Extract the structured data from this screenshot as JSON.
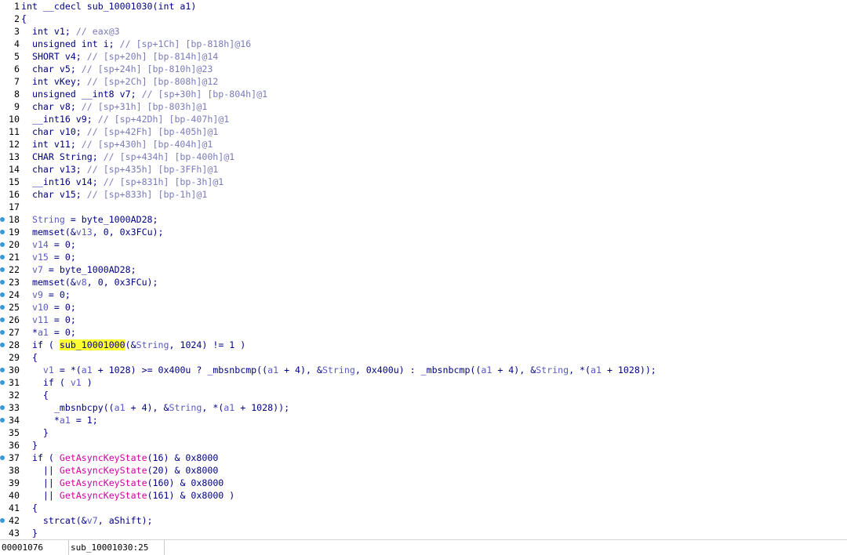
{
  "pseudocode": {
    "lines": [
      {
        "num": "1",
        "bp": false,
        "segs": [
          {
            "t": "int __cdecl sub_10001030(int a1)",
            "c": "k"
          }
        ]
      },
      {
        "num": "2",
        "bp": false,
        "segs": [
          {
            "t": "{",
            "c": "k"
          }
        ]
      },
      {
        "num": "3",
        "bp": false,
        "segs": [
          {
            "t": "  int v1; ",
            "c": "k"
          },
          {
            "t": "// eax@3",
            "c": "c"
          }
        ]
      },
      {
        "num": "4",
        "bp": false,
        "segs": [
          {
            "t": "  unsigned int i; ",
            "c": "k"
          },
          {
            "t": "// [sp+1Ch] [bp-818h]@16",
            "c": "c"
          }
        ]
      },
      {
        "num": "5",
        "bp": false,
        "segs": [
          {
            "t": "  SHORT v4; ",
            "c": "k"
          },
          {
            "t": "// [sp+20h] [bp-814h]@14",
            "c": "c"
          }
        ]
      },
      {
        "num": "6",
        "bp": false,
        "segs": [
          {
            "t": "  char v5; ",
            "c": "k"
          },
          {
            "t": "// [sp+24h] [bp-810h]@23",
            "c": "c"
          }
        ]
      },
      {
        "num": "7",
        "bp": false,
        "segs": [
          {
            "t": "  int vKey; ",
            "c": "k"
          },
          {
            "t": "// [sp+2Ch] [bp-808h]@12",
            "c": "c"
          }
        ]
      },
      {
        "num": "8",
        "bp": false,
        "segs": [
          {
            "t": "  unsigned __int8 v7; ",
            "c": "k"
          },
          {
            "t": "// [sp+30h] [bp-804h]@1",
            "c": "c"
          }
        ]
      },
      {
        "num": "9",
        "bp": false,
        "segs": [
          {
            "t": "  char v8; ",
            "c": "k"
          },
          {
            "t": "// [sp+31h] [bp-803h]@1",
            "c": "c"
          }
        ]
      },
      {
        "num": "10",
        "bp": false,
        "segs": [
          {
            "t": "  __int16 v9; ",
            "c": "k"
          },
          {
            "t": "// [sp+42Dh] [bp-407h]@1",
            "c": "c"
          }
        ]
      },
      {
        "num": "11",
        "bp": false,
        "segs": [
          {
            "t": "  char v10; ",
            "c": "k"
          },
          {
            "t": "// [sp+42Fh] [bp-405h]@1",
            "c": "c"
          }
        ]
      },
      {
        "num": "12",
        "bp": false,
        "segs": [
          {
            "t": "  int v11; ",
            "c": "k"
          },
          {
            "t": "// [sp+430h] [bp-404h]@1",
            "c": "c"
          }
        ]
      },
      {
        "num": "13",
        "bp": false,
        "segs": [
          {
            "t": "  CHAR String; ",
            "c": "k"
          },
          {
            "t": "// [sp+434h] [bp-400h]@1",
            "c": "c"
          }
        ]
      },
      {
        "num": "14",
        "bp": false,
        "segs": [
          {
            "t": "  char v13; ",
            "c": "k"
          },
          {
            "t": "// [sp+435h] [bp-3FFh]@1",
            "c": "c"
          }
        ]
      },
      {
        "num": "15",
        "bp": false,
        "segs": [
          {
            "t": "  __int16 v14; ",
            "c": "k"
          },
          {
            "t": "// [sp+831h] [bp-3h]@1",
            "c": "c"
          }
        ]
      },
      {
        "num": "16",
        "bp": false,
        "segs": [
          {
            "t": "  char v15; ",
            "c": "k"
          },
          {
            "t": "// [sp+833h] [bp-1h]@1",
            "c": "c"
          }
        ]
      },
      {
        "num": "17",
        "bp": false,
        "segs": [
          {
            "t": "",
            "c": "k"
          }
        ]
      },
      {
        "num": "18",
        "bp": true,
        "segs": [
          {
            "t": "  ",
            "c": "k"
          },
          {
            "t": "String",
            "c": "v"
          },
          {
            "t": " = byte_1000AD28;",
            "c": "k"
          }
        ]
      },
      {
        "num": "19",
        "bp": true,
        "segs": [
          {
            "t": "  memset(&",
            "c": "k"
          },
          {
            "t": "v13",
            "c": "v"
          },
          {
            "t": ", 0, 0x3FCu);",
            "c": "k"
          }
        ]
      },
      {
        "num": "20",
        "bp": true,
        "segs": [
          {
            "t": "  ",
            "c": "k"
          },
          {
            "t": "v14",
            "c": "v"
          },
          {
            "t": " = 0;",
            "c": "k"
          }
        ]
      },
      {
        "num": "21",
        "bp": true,
        "segs": [
          {
            "t": "  ",
            "c": "k"
          },
          {
            "t": "v15",
            "c": "v"
          },
          {
            "t": " = 0;",
            "c": "k"
          }
        ]
      },
      {
        "num": "22",
        "bp": true,
        "segs": [
          {
            "t": "  ",
            "c": "k"
          },
          {
            "t": "v7",
            "c": "v"
          },
          {
            "t": " = byte_1000AD28;",
            "c": "k"
          }
        ]
      },
      {
        "num": "23",
        "bp": true,
        "segs": [
          {
            "t": "  memset(&",
            "c": "k"
          },
          {
            "t": "v8",
            "c": "v"
          },
          {
            "t": ", 0, 0x3FCu);",
            "c": "k"
          }
        ]
      },
      {
        "num": "24",
        "bp": true,
        "segs": [
          {
            "t": "  ",
            "c": "k"
          },
          {
            "t": "v9",
            "c": "v"
          },
          {
            "t": " = 0;",
            "c": "k"
          }
        ]
      },
      {
        "num": "25",
        "bp": true,
        "segs": [
          {
            "t": "  ",
            "c": "k"
          },
          {
            "t": "v10",
            "c": "v"
          },
          {
            "t": " = 0;",
            "c": "k"
          }
        ]
      },
      {
        "num": "26",
        "bp": true,
        "segs": [
          {
            "t": "  ",
            "c": "k"
          },
          {
            "t": "v11",
            "c": "v"
          },
          {
            "t": " = 0;",
            "c": "k"
          }
        ]
      },
      {
        "num": "27",
        "bp": true,
        "segs": [
          {
            "t": "  *",
            "c": "k"
          },
          {
            "t": "a1",
            "c": "v"
          },
          {
            "t": " = 0;",
            "c": "k"
          }
        ]
      },
      {
        "num": "28",
        "bp": true,
        "segs": [
          {
            "t": "  if ( ",
            "c": "k"
          },
          {
            "t": "sub_10001000",
            "c": "hl"
          },
          {
            "t": "(&",
            "c": "k"
          },
          {
            "t": "String",
            "c": "v"
          },
          {
            "t": ", 1024) != 1 )",
            "c": "k"
          }
        ]
      },
      {
        "num": "29",
        "bp": false,
        "segs": [
          {
            "t": "  {",
            "c": "k"
          }
        ]
      },
      {
        "num": "30",
        "bp": true,
        "segs": [
          {
            "t": "    ",
            "c": "k"
          },
          {
            "t": "v1",
            "c": "v"
          },
          {
            "t": " = *(",
            "c": "k"
          },
          {
            "t": "a1",
            "c": "v"
          },
          {
            "t": " + 1028) >= 0x400u ? _mbsnbcmp((",
            "c": "k"
          },
          {
            "t": "a1",
            "c": "v"
          },
          {
            "t": " + 4), &",
            "c": "k"
          },
          {
            "t": "String",
            "c": "v"
          },
          {
            "t": ", 0x400u) : _mbsnbcmp((",
            "c": "k"
          },
          {
            "t": "a1",
            "c": "v"
          },
          {
            "t": " + 4), &",
            "c": "k"
          },
          {
            "t": "String",
            "c": "v"
          },
          {
            "t": ", *(",
            "c": "k"
          },
          {
            "t": "a1",
            "c": "v"
          },
          {
            "t": " + 1028));",
            "c": "k"
          }
        ]
      },
      {
        "num": "31",
        "bp": true,
        "segs": [
          {
            "t": "    if ( ",
            "c": "k"
          },
          {
            "t": "v1",
            "c": "v"
          },
          {
            "t": " )",
            "c": "k"
          }
        ]
      },
      {
        "num": "32",
        "bp": false,
        "segs": [
          {
            "t": "    {",
            "c": "k"
          }
        ]
      },
      {
        "num": "33",
        "bp": true,
        "segs": [
          {
            "t": "      _mbsnbcpy((",
            "c": "k"
          },
          {
            "t": "a1",
            "c": "v"
          },
          {
            "t": " + 4), &",
            "c": "k"
          },
          {
            "t": "String",
            "c": "v"
          },
          {
            "t": ", *(",
            "c": "k"
          },
          {
            "t": "a1",
            "c": "v"
          },
          {
            "t": " + 1028));",
            "c": "k"
          }
        ]
      },
      {
        "num": "34",
        "bp": true,
        "segs": [
          {
            "t": "      *",
            "c": "k"
          },
          {
            "t": "a1",
            "c": "v"
          },
          {
            "t": " = 1;",
            "c": "k"
          }
        ]
      },
      {
        "num": "35",
        "bp": false,
        "segs": [
          {
            "t": "    }",
            "c": "k"
          }
        ]
      },
      {
        "num": "36",
        "bp": false,
        "segs": [
          {
            "t": "  }",
            "c": "k"
          }
        ]
      },
      {
        "num": "37",
        "bp": true,
        "segs": [
          {
            "t": "  if ( ",
            "c": "k"
          },
          {
            "t": "GetAsyncKeyState",
            "c": "f"
          },
          {
            "t": "(16) & 0x8000",
            "c": "k"
          }
        ]
      },
      {
        "num": "38",
        "bp": false,
        "segs": [
          {
            "t": "    || ",
            "c": "k"
          },
          {
            "t": "GetAsyncKeyState",
            "c": "f"
          },
          {
            "t": "(20) & 0x8000",
            "c": "k"
          }
        ]
      },
      {
        "num": "39",
        "bp": false,
        "segs": [
          {
            "t": "    || ",
            "c": "k"
          },
          {
            "t": "GetAsyncKeyState",
            "c": "f"
          },
          {
            "t": "(160) & 0x8000",
            "c": "k"
          }
        ]
      },
      {
        "num": "40",
        "bp": false,
        "segs": [
          {
            "t": "    || ",
            "c": "k"
          },
          {
            "t": "GetAsyncKeyState",
            "c": "f"
          },
          {
            "t": "(161) & 0x8000 )",
            "c": "k"
          }
        ]
      },
      {
        "num": "41",
        "bp": false,
        "segs": [
          {
            "t": "  {",
            "c": "k"
          }
        ]
      },
      {
        "num": "42",
        "bp": true,
        "segs": [
          {
            "t": "    strcat(&",
            "c": "k"
          },
          {
            "t": "v7",
            "c": "v"
          },
          {
            "t": ", aShift);",
            "c": "k"
          }
        ]
      },
      {
        "num": "43",
        "bp": false,
        "segs": [
          {
            "t": "  }",
            "c": "k"
          }
        ]
      }
    ]
  },
  "statusbar": {
    "address": "00001076",
    "location": "sub_10001030:25"
  },
  "colors": {
    "code_text": "#000080",
    "comment": "#7a7aba",
    "variable": "#5a5ac0",
    "api_function": "#d000a0",
    "highlight": "#ffff33",
    "breakpoint_dot": "#3a9ad9"
  }
}
